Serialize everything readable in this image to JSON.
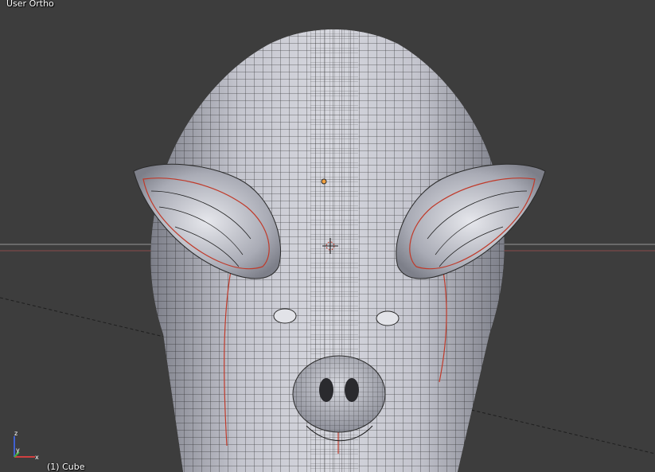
{
  "viewport": {
    "view_name": "User Ortho",
    "object_info": "(1) Cube",
    "background_color": "#3d3d3d"
  },
  "axis_gizmo": {
    "x_label": "x",
    "y_label": "y",
    "z_label": "z",
    "x_color": "#d04040",
    "y_color": "#40b040",
    "z_color": "#4060d0"
  },
  "model": {
    "mesh_fill": "#b8b9c2",
    "wire_color": "#1a1a1a",
    "seam_color": "#c03a2a",
    "origin_color": "#f0a040"
  }
}
